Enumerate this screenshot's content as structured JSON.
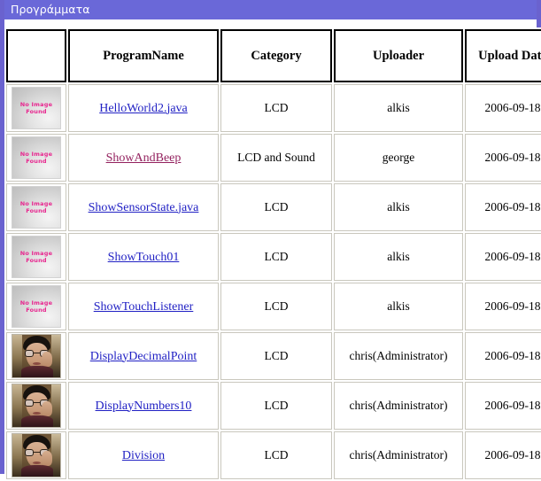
{
  "window": {
    "title": "Προγράμματα",
    "titlebar_color": "#6a68d8",
    "border_color": "#6a62cf"
  },
  "table": {
    "columns": [
      {
        "key": "thumb",
        "label": ""
      },
      {
        "key": "name",
        "label": "ProgramName"
      },
      {
        "key": "category",
        "label": "Category"
      },
      {
        "key": "uploader",
        "label": "Uploader"
      },
      {
        "key": "date",
        "label": "Upload Date"
      }
    ],
    "placeholder_image": {
      "line1": "No Image",
      "line2": "Found"
    },
    "link_color": "#2121c4",
    "visited_link_color": "#93215e",
    "rows": [
      {
        "thumb": "no-image",
        "name": "HelloWorld2.java",
        "visited": false,
        "category": "LCD",
        "uploader": "alkis",
        "date": "2006-09-18"
      },
      {
        "thumb": "no-image",
        "name": "ShowAndBeep",
        "visited": true,
        "category": "LCD and Sound",
        "uploader": "george",
        "date": "2006-09-18"
      },
      {
        "thumb": "no-image",
        "name": "ShowSensorState.java",
        "visited": false,
        "category": "LCD",
        "uploader": "alkis",
        "date": "2006-09-18"
      },
      {
        "thumb": "no-image",
        "name": "ShowTouch01",
        "visited": false,
        "category": "LCD",
        "uploader": "alkis",
        "date": "2006-09-18"
      },
      {
        "thumb": "no-image",
        "name": "ShowTouchListener",
        "visited": false,
        "category": "LCD",
        "uploader": "alkis",
        "date": "2006-09-18"
      },
      {
        "thumb": "avatar",
        "name": "DisplayDecimalPoint",
        "visited": false,
        "category": "LCD",
        "uploader": "chris(Administrator)",
        "date": "2006-09-18"
      },
      {
        "thumb": "avatar",
        "name": "DisplayNumbers10",
        "visited": false,
        "category": "LCD",
        "uploader": "chris(Administrator)",
        "date": "2006-09-18"
      },
      {
        "thumb": "avatar",
        "name": "Division",
        "visited": false,
        "category": "LCD",
        "uploader": "chris(Administrator)",
        "date": "2006-09-18"
      }
    ]
  }
}
